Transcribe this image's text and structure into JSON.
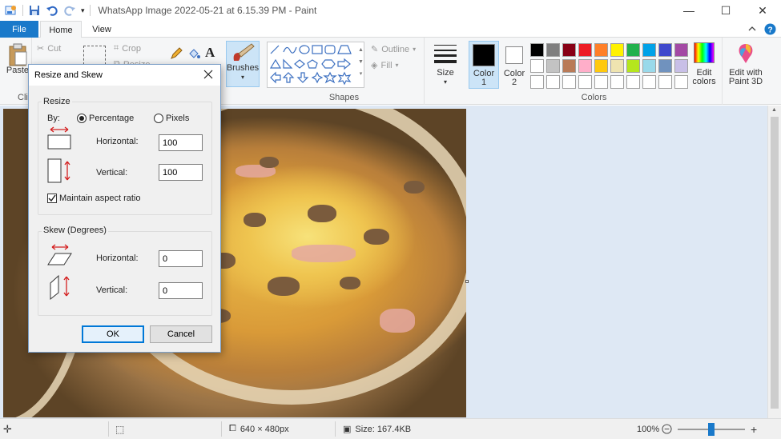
{
  "window": {
    "title": "WhatsApp Image 2022-05-21 at 6.15.39 PM - Paint",
    "minimize": "—",
    "maximize": "☐",
    "close": "✕"
  },
  "tabs": {
    "file": "File",
    "home": "Home",
    "view": "View"
  },
  "ribbon": {
    "clipboard": {
      "paste": "Paste",
      "cut": "Cut",
      "label": "Cli"
    },
    "image": {
      "crop": "Crop",
      "resize": "Resize"
    },
    "brushes": "Brushes",
    "shapes": {
      "label": "Shapes",
      "outline": "Outline",
      "fill": "Fill"
    },
    "size": "Size",
    "color1": "Color 1",
    "color2": "Color 2",
    "colors_label": "Colors",
    "edit_colors": "Edit colors",
    "paint3d": "Edit with Paint 3D",
    "palette_row1": [
      "#000000",
      "#7f7f7f",
      "#880015",
      "#ed1c24",
      "#ff7f27",
      "#fff200",
      "#22b14c",
      "#00a2e8",
      "#3f48cc",
      "#a349a4"
    ],
    "palette_row2": [
      "#ffffff",
      "#c3c3c3",
      "#b97a57",
      "#ffaec9",
      "#ffc90e",
      "#efe4b0",
      "#b5e61d",
      "#99d9ea",
      "#7092be",
      "#c8bfe7"
    ],
    "palette_row3": [
      "#ffffff",
      "#ffffff",
      "#ffffff",
      "#ffffff",
      "#ffffff",
      "#ffffff",
      "#ffffff",
      "#ffffff",
      "#ffffff",
      "#ffffff"
    ]
  },
  "dialog": {
    "title": "Resize and Skew",
    "resize_legend": "Resize",
    "by_label": "By:",
    "percentage": "Percentage",
    "pixels": "Pixels",
    "horizontal": "Horizontal:",
    "vertical": "Vertical:",
    "resize_h": "100",
    "resize_v": "100",
    "maintain": "Maintain aspect ratio",
    "skew_legend": "Skew (Degrees)",
    "skew_h": "0",
    "skew_v": "0",
    "ok": "OK",
    "cancel": "Cancel"
  },
  "status": {
    "dimensions": "640 × 480px",
    "size": "Size: 167.4KB",
    "zoom": "100%",
    "zoom_level": 0.5
  }
}
